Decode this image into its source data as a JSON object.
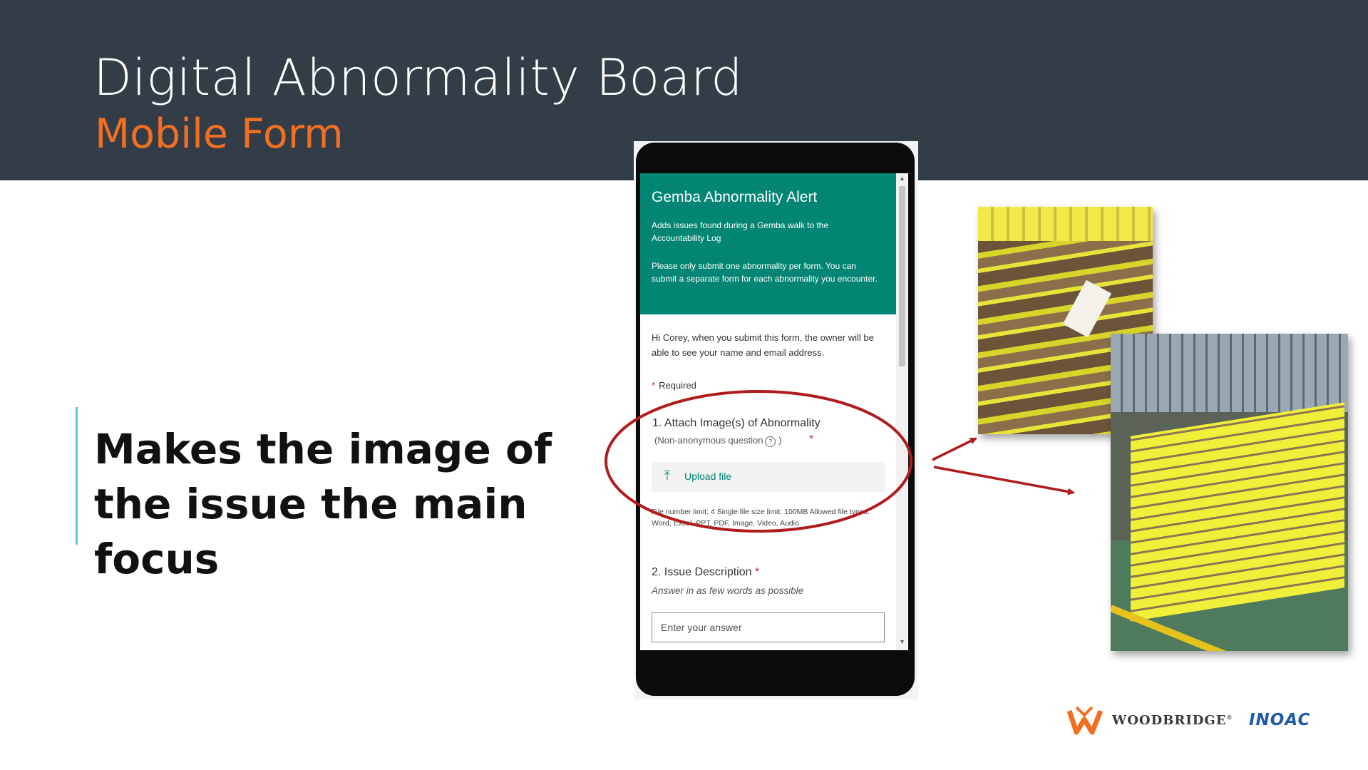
{
  "slide": {
    "title": "Digital Abnormality Board",
    "subtitle": "Mobile Form",
    "focus_text": "Makes the image of the issue the main focus"
  },
  "form": {
    "header_title": "Gemba Abnormality Alert",
    "description_1": "Adds issues found during a Gemba walk to the Accountability Log",
    "description_2": "Please only submit one abnormality per form.  You can submit a separate form for each abnormality you encounter.",
    "intro": "Hi Corey, when you submit this form, the owner will be able to see your name and email address.",
    "required_label": "Required",
    "q1": {
      "title": "1. Attach Image(s) of Abnormality",
      "subtitle": "(Non-anonymous question",
      "subtitle_end": ")",
      "help_glyph": "?",
      "upload_label": "Upload file",
      "upload_icon": "upload-arrow-icon",
      "limits": "File number limit: 4    Single file size limit: 100MB    Allowed file types: Word, Excel, PPT, PDF, Image, Video, Audio"
    },
    "q2": {
      "title": "2. Issue Description",
      "hint": "Answer in as few words as possible",
      "placeholder": "Enter your answer"
    },
    "required_star": "*"
  },
  "colors": {
    "banner": "#333d47",
    "subtitle": "#f26f21",
    "form_header": "#038574",
    "annotation": "#b01c1c",
    "accent_bar": "#5bc8e8"
  },
  "logos": {
    "woodbridge": "WOODBRIDGE",
    "woodbridge_mark": "®",
    "inoac": "INOAC"
  }
}
